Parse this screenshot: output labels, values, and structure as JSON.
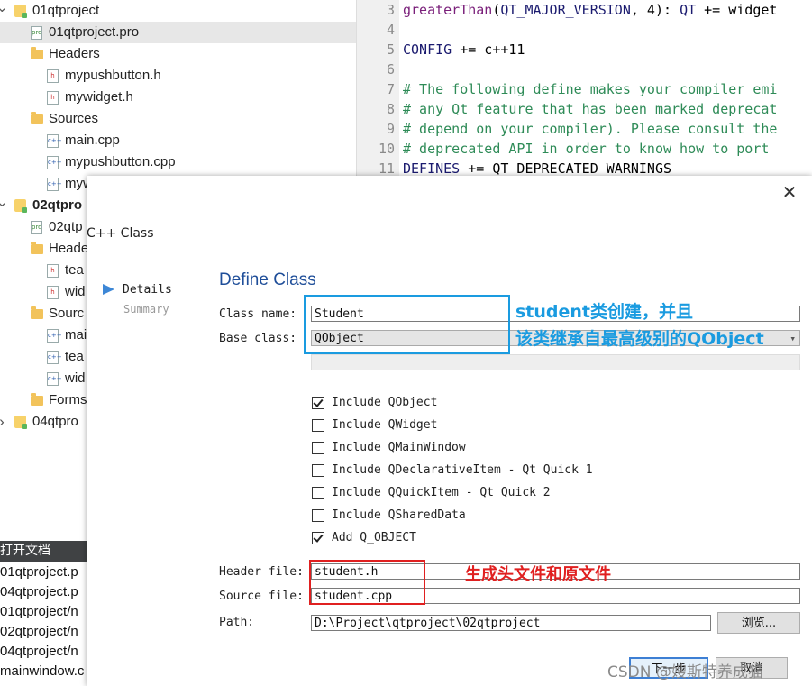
{
  "tree": [
    {
      "label": "01qtproject",
      "type": "project",
      "chev": "down",
      "bold": false
    },
    {
      "label": "01qtproject.pro",
      "type": "pro",
      "chev": "",
      "bold": false,
      "selected": true
    },
    {
      "label": "Headers",
      "type": "folder-h",
      "chev": "down"
    },
    {
      "label": "mypushbutton.h",
      "type": "h"
    },
    {
      "label": "mywidget.h",
      "type": "h"
    },
    {
      "label": "Sources",
      "type": "folder-c",
      "chev": "down"
    },
    {
      "label": "main.cpp",
      "type": "cpp"
    },
    {
      "label": "mypushbutton.cpp",
      "type": "cpp"
    },
    {
      "label": "myw",
      "type": "cpp"
    },
    {
      "label": "02qtpro",
      "type": "project",
      "chev": "down",
      "bold": true
    },
    {
      "label": "02qtp",
      "type": "pro"
    },
    {
      "label": "Heade",
      "type": "folder-h",
      "chev": "down"
    },
    {
      "label": "tea",
      "type": "h"
    },
    {
      "label": "wid",
      "type": "h"
    },
    {
      "label": "Sourc",
      "type": "folder-c",
      "chev": "down"
    },
    {
      "label": "mai",
      "type": "cpp"
    },
    {
      "label": "tea",
      "type": "cpp"
    },
    {
      "label": "wid",
      "type": "cpp"
    },
    {
      "label": "Forms",
      "type": "folder-f",
      "chev": "right"
    },
    {
      "label": "04qtpro",
      "type": "project",
      "chev": "right"
    }
  ],
  "open_docs": {
    "header": "打开文档",
    "items": [
      "01qtproject.p",
      "04qtproject.p",
      "01qtproject/n",
      "02qtproject/n",
      "04qtproject/n",
      "mainwindow.c"
    ]
  },
  "editor": {
    "lines": [
      {
        "n": "3",
        "parts": [
          [
            "fn",
            "greaterThan"
          ],
          [
            "",
            "("
          ],
          [
            "mac",
            "QT_MAJOR_VERSION"
          ],
          [
            "",
            ", 4): "
          ],
          [
            "mac",
            "QT"
          ],
          [
            "",
            " += widget"
          ]
        ]
      },
      {
        "n": "4",
        "parts": []
      },
      {
        "n": "5",
        "parts": [
          [
            "mac",
            "CONFIG"
          ],
          [
            "",
            " += c++11"
          ]
        ]
      },
      {
        "n": "6",
        "parts": []
      },
      {
        "n": "7",
        "parts": [
          [
            "cm",
            "# The following define makes your compiler emi"
          ]
        ]
      },
      {
        "n": "8",
        "parts": [
          [
            "cm",
            "# any Qt feature that has been marked deprecat"
          ]
        ]
      },
      {
        "n": "9",
        "parts": [
          [
            "cm",
            "# depend on your compiler). Please consult the"
          ]
        ]
      },
      {
        "n": "10",
        "parts": [
          [
            "cm",
            "# deprecated API in order to know how to port"
          ]
        ]
      },
      {
        "n": "11",
        "parts": [
          [
            "mac",
            "DEFINES"
          ],
          [
            "",
            " += QT_DEPRECATED_WARNINGS"
          ]
        ]
      }
    ]
  },
  "dialog": {
    "close": "✕",
    "title": "C++ Class",
    "steps": {
      "active": "Details",
      "next": "Summary"
    },
    "page_title": "Define Class",
    "class_name_label": "Class name:",
    "class_name": "Student",
    "base_class_label": "Base class:",
    "base_class": "QObject",
    "checkboxes": [
      {
        "label": "Include QObject",
        "checked": true
      },
      {
        "label": "Include QWidget",
        "checked": false
      },
      {
        "label": "Include QMainWindow",
        "checked": false
      },
      {
        "label": "Include QDeclarativeItem - Qt Quick 1",
        "checked": false
      },
      {
        "label": "Include QQuickItem - Qt Quick 2",
        "checked": false
      },
      {
        "label": "Include QSharedData",
        "checked": false
      },
      {
        "label": "Add Q_OBJECT",
        "checked": true
      }
    ],
    "header_file_label": "Header file:",
    "header_file": "student.h",
    "source_file_label": "Source file:",
    "source_file": "student.cpp",
    "path_label": "Path:",
    "path": "D:\\Project\\qtproject\\02qtproject",
    "browse": "浏览...",
    "next_button": "下一步",
    "cancel_button": "取消"
  },
  "annotations": {
    "class_note_line1": "student类创建，并且",
    "class_note_line2": "该类继承自最高级别的QObject",
    "file_note": "生成头文件和原文件",
    "class_note_color": "#1a9be0",
    "file_note_color": "#e02020"
  },
  "watermark": "CSDN @嫂斯特养成猫"
}
